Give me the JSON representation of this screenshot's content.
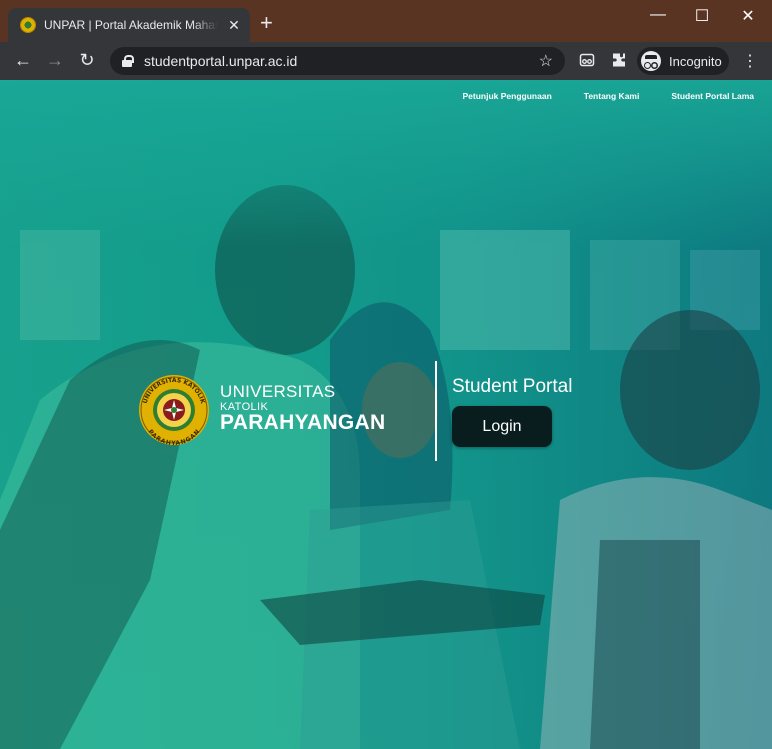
{
  "browser": {
    "tab_title": "UNPAR | Portal Akademik Mahasiswa",
    "tab_close": "✕",
    "new_tab": "+",
    "url": "studentportal.unpar.ac.id",
    "incognito_label": "Incognito",
    "window_controls": {
      "minimize": "—",
      "maximize": "☐",
      "close": "✕"
    },
    "icons": [
      "back-icon",
      "forward-icon",
      "reload-icon",
      "lock-icon",
      "star-icon",
      "reading-mode-icon",
      "extensions-icon",
      "incognito-icon",
      "menu-icon"
    ]
  },
  "nav": {
    "items": [
      "Petunjuk Penggunaan",
      "Tentang Kami",
      "Student Portal Lama"
    ]
  },
  "logo": {
    "line1": "UNIVERSITAS",
    "line2": "KATOLIK",
    "line3": "PARAHYANGAN",
    "seal_text_top": "UNIVERSITAS KATOLIK",
    "seal_text_bottom": "PARAHYANGAN"
  },
  "portal": {
    "title": "Student Portal",
    "login_label": "Login"
  },
  "colors": {
    "overlay_left": "#1aa28d",
    "overlay_right": "#0d6d7c",
    "button_bg": "#0a1d1e",
    "seal_gold": "#e0b100",
    "seal_green": "#2e7d32"
  }
}
